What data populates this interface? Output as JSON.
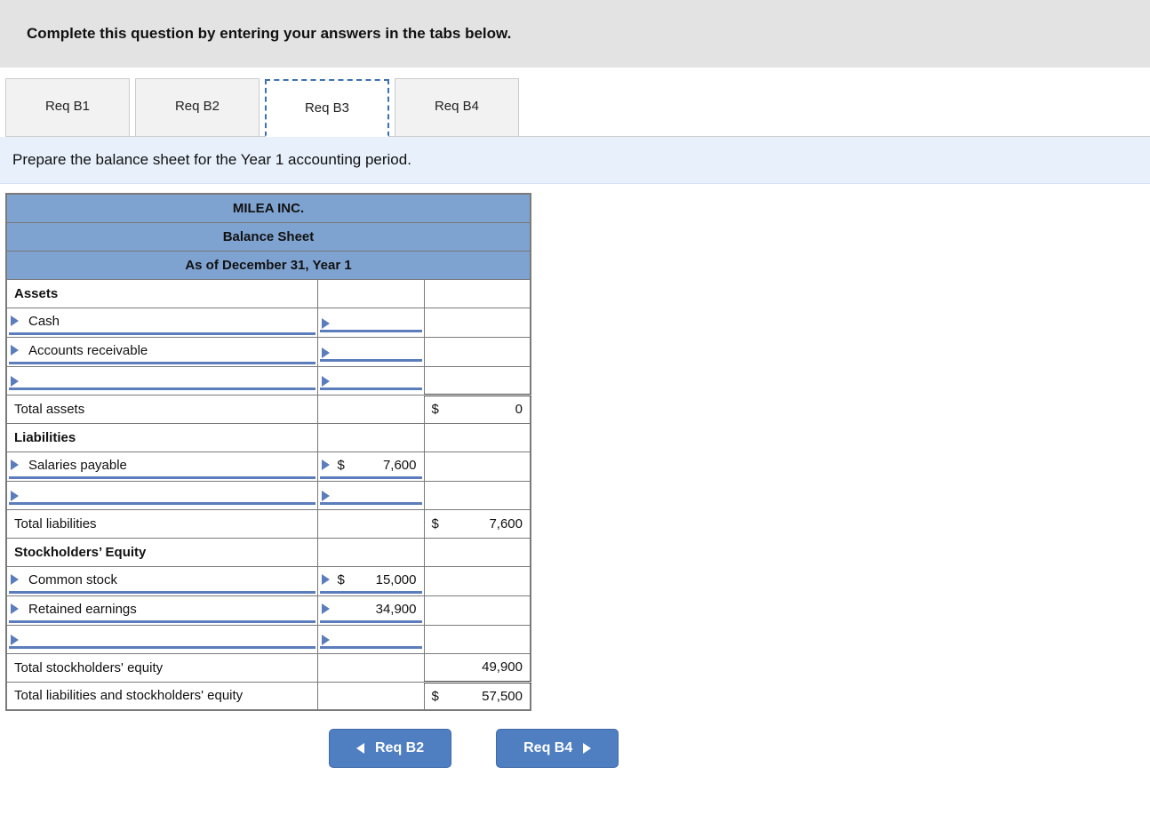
{
  "instruction": "Complete this question by entering your answers in the tabs below.",
  "tabs": [
    "Req B1",
    "Req B2",
    "Req B3",
    "Req B4"
  ],
  "active_tab_index": 2,
  "prompt": "Prepare the balance sheet for the Year 1 accounting period.",
  "sheet": {
    "company": "MILEA INC.",
    "title": "Balance Sheet",
    "asof": "As of December 31, Year 1",
    "sections": {
      "assets_head": "Assets",
      "cash": "Cash",
      "ar": "Accounts receivable",
      "total_assets": {
        "label": "Total assets",
        "sym": "$",
        "val": "0"
      },
      "liab_head": "Liabilities",
      "salaries": {
        "label": "Salaries payable",
        "sym": "$",
        "val": "7,600"
      },
      "total_liab": {
        "label": "Total liabilities",
        "sym": "$",
        "val": "7,600"
      },
      "se_head": "Stockholders’ Equity",
      "common": {
        "label": "Common stock",
        "sym": "$",
        "val": "15,000"
      },
      "retained": {
        "label": "Retained earnings",
        "val": "34,900"
      },
      "total_se": {
        "label": "Total stockholders' equity",
        "val": "49,900"
      },
      "total_lse": {
        "label": "Total liabilities and stockholders' equity",
        "sym": "$",
        "val": "57,500"
      }
    }
  },
  "nav": {
    "prev": "Req B2",
    "next": "Req B4"
  }
}
